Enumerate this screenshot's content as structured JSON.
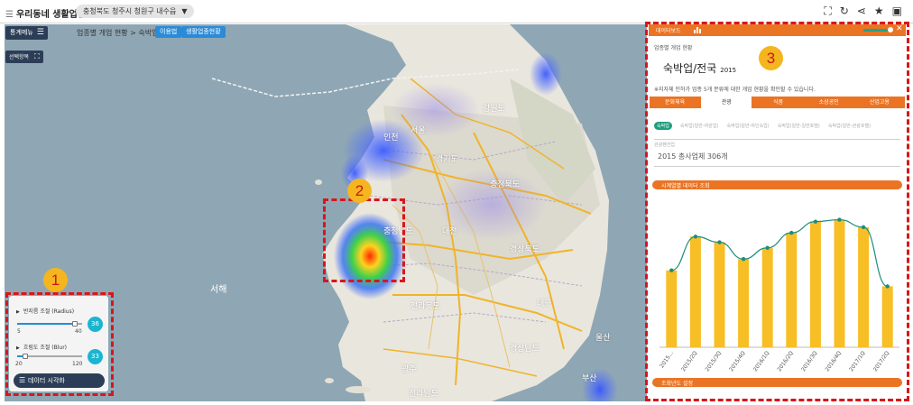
{
  "app": {
    "title": "우리동네 생활업종",
    "region": "충청북도 청주시 청원구 내수읍"
  },
  "top_icons": [
    "fullscreen-icon",
    "refresh-icon",
    "share-icon",
    "star-icon",
    "print-icon"
  ],
  "toolbar": {
    "menu_label": "통계메뉴",
    "breadcrumb": "업종별 개업 현황 > 숙박업",
    "chip_usage": "이용법",
    "chip_industry": "생활업종현황",
    "region_select": "선택항목"
  },
  "map_labels": {
    "provinces": [
      "강원도",
      "경기도",
      "충청북도",
      "충청남도",
      "경상북도",
      "전라북도",
      "경상남도",
      "전라남도"
    ],
    "cities": [
      "서울",
      "인천",
      "대전",
      "대구",
      "부산",
      "광주",
      "울산"
    ],
    "sea": "서해"
  },
  "controls": {
    "radius_label": "반지름 조절 (Radius)",
    "radius_min": "5",
    "radius_max": "40",
    "radius_value": "36",
    "radius_fraction": 0.89,
    "blur_label": "흐림도 조절 (Blur)",
    "blur_min": "20",
    "blur_max": "120",
    "blur_value": "33",
    "blur_fraction": 0.13,
    "viz_button": "데이터 시각화"
  },
  "annotations": {
    "one": "1",
    "two": "2",
    "three": "3",
    "color": "#d8161b"
  },
  "panel": {
    "header": "데이터보드",
    "subtitle": "업종별 개업 현황",
    "title": "숙박업/전국",
    "title_year": "2015",
    "note": "※지자체 인허가 업종 5개 분류에 대한 개업 현황을 확인할 수 있습니다.",
    "tabs": [
      "문화체육",
      "관광",
      "식품",
      "소상공인",
      "산업고용"
    ],
    "active_tab": 1,
    "subtabs": [
      "숙박업",
      "숙박업(일반-여관업)",
      "숙박업(일반-여인숙업)",
      "숙박업(일반-일반호텔)",
      "숙박업(일반-관광호텔)",
      "관광펜션업"
    ],
    "total": "2015 총사업체 306개",
    "section_trend": "시계열별 데이터 조회",
    "section_year": "조회년도 설정",
    "accent": "#ea7424",
    "teal": "#1fa38c"
  },
  "chart_data": {
    "type": "bar",
    "categories": [
      "2015...",
      "2015/2Q",
      "2015/3Q",
      "2015/4Q",
      "2016/1Q",
      "2016/2Q",
      "2016/3Q",
      "2016/4Q",
      "2017/1Q",
      "2017/2Q"
    ],
    "series": [
      {
        "values": [
          82,
          118,
          112,
          94,
          106,
          122,
          134,
          136,
          128,
          65
        ]
      }
    ],
    "line_overlay": true,
    "ylim": [
      0,
      150
    ],
    "bar_color": "#f7be26",
    "line_color": "#1d8c7c"
  }
}
